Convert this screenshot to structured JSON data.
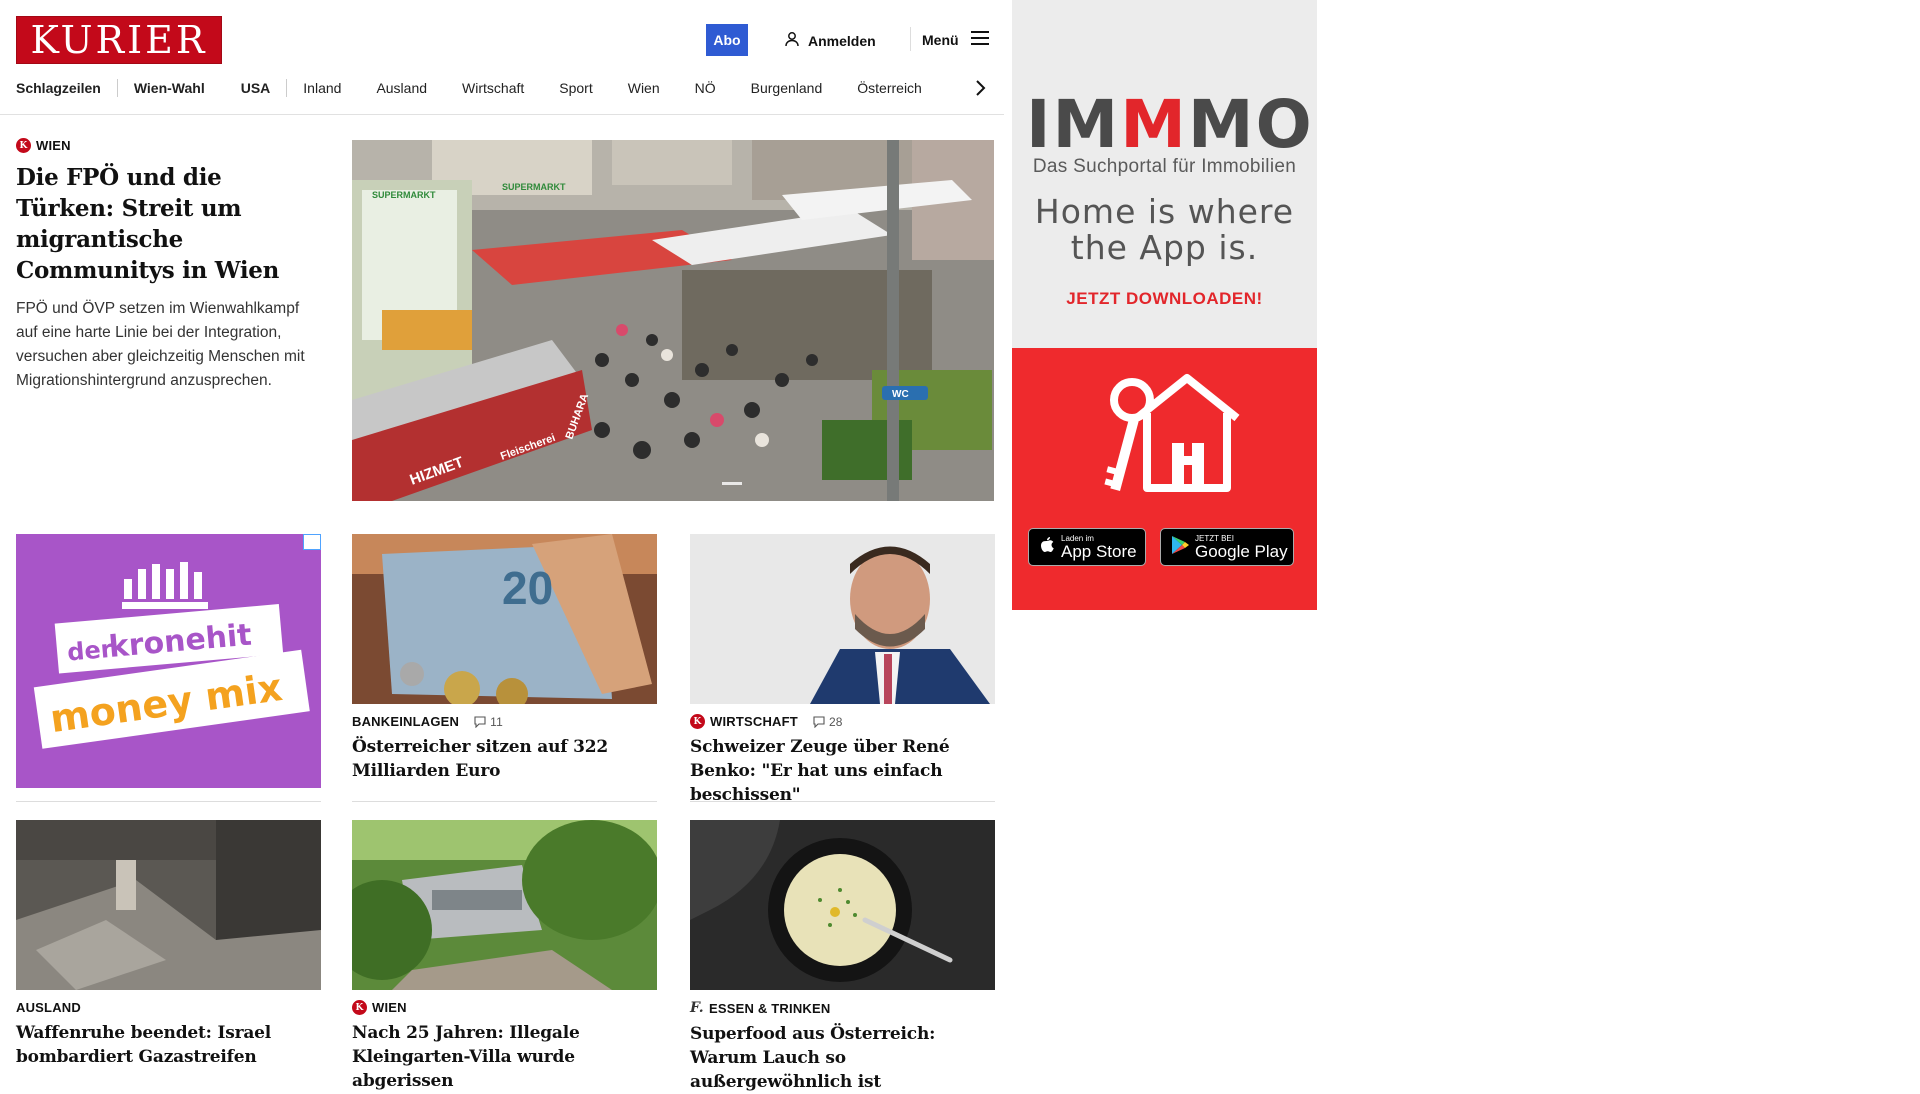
{
  "header": {
    "logo_text": "KURIER",
    "abo_label": "Abo",
    "login_label": "Anmelden",
    "menu_label": "Menü"
  },
  "nav": {
    "items": [
      "Schlagzeilen",
      "Wien-Wahl",
      "USA",
      "Inland",
      "Ausland",
      "Wirtschaft",
      "Sport",
      "Wien",
      "NÖ",
      "Burgenland",
      "Österreich"
    ]
  },
  "lead": {
    "kicker": "WIEN",
    "title": "Die FPÖ und die Türken: Streit um migrantische Communitys in Wien",
    "teaser": "FPÖ und ÖVP setzen im Wienwahlkampf auf eine harte Linie bei der Integration, versuchen aber gleichzeitig Menschen mit Migrationshintergrund anzusprechen.",
    "image_labels": [
      "SUPERMARKT",
      "SUPERMARKT",
      "HIZMET",
      "Fleischerei",
      "BUHARA",
      "WC"
    ]
  },
  "ad_left": {
    "line1": "der",
    "line2": "kronehit",
    "line3": "money mix"
  },
  "cards": [
    {
      "kicker": "BANKEINLAGEN",
      "comments": "11",
      "title": "Österreicher sitzen auf 322 Milliarden Euro",
      "image_label": "20"
    },
    {
      "kicker": "WIRTSCHAFT",
      "comments": "28",
      "title": "Schweizer Zeuge über René Benko: \"Er hat uns einfach beschissen\""
    },
    {
      "kicker": "AUSLAND",
      "title": "Waffenruhe beendet: Israel bombardiert Gazastreifen"
    },
    {
      "kicker": "WIEN",
      "title": "Nach 25 Jahren: Illegale Kleingarten-Villa wurde abgerissen"
    },
    {
      "kicker": "ESSEN & TRINKEN",
      "title": "Superfood aus Österreich: Warum Lauch so außergewöhnlich ist"
    }
  ],
  "ad_right": {
    "logo_parts": [
      "IM",
      "M",
      "MO"
    ],
    "subtitle": "Das Suchportal für Immobilien",
    "claim_line1": "Home is where",
    "claim_line2": "the App is.",
    "cta": "JETZT DOWNLOADEN!",
    "appstore_small": "Laden im",
    "appstore_big": "App Store",
    "googleplay_small": "JETZT BEI",
    "googleplay_big": "Google Play"
  },
  "colors": {
    "brand_red": "#c3091a",
    "abo_blue": "#2f5bd3",
    "immmo_red": "#e2262b",
    "kronehit_purple": "#a855c8"
  }
}
